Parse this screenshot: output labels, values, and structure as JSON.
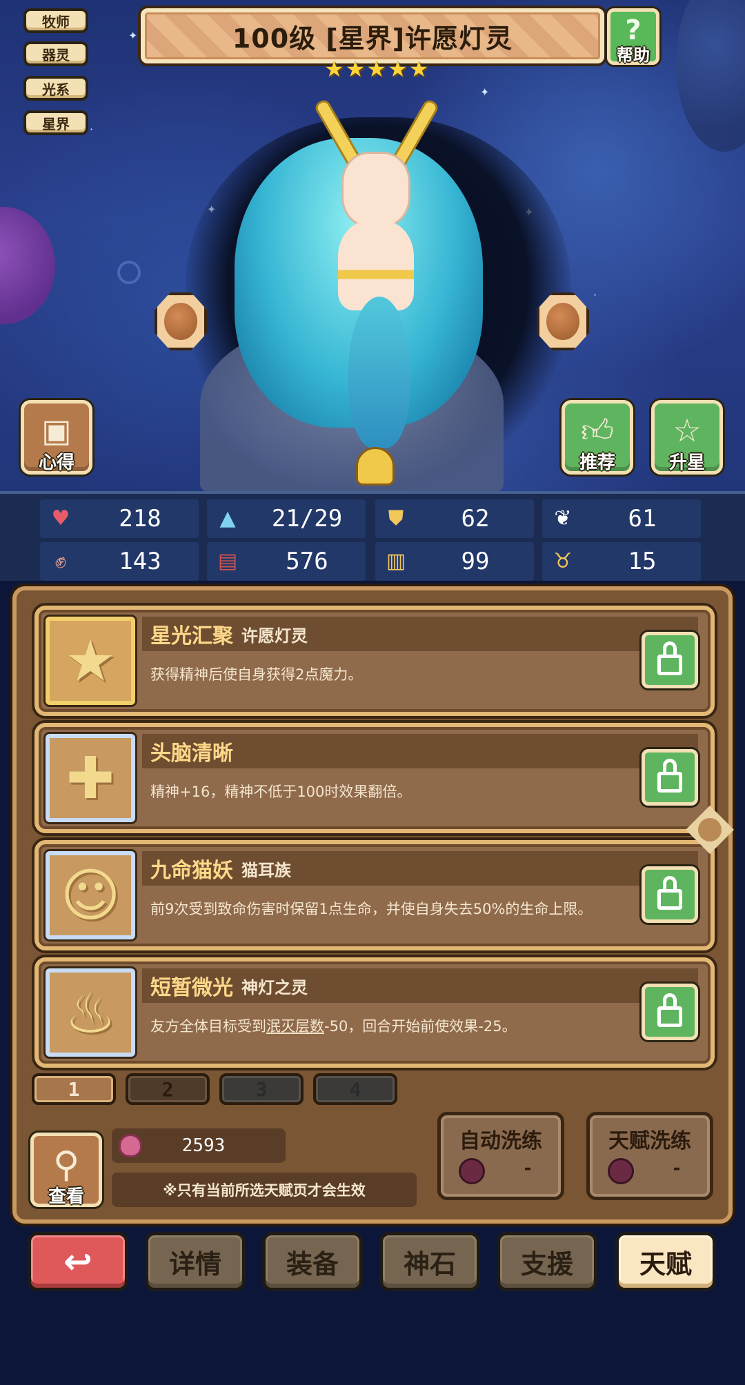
{
  "hero": {
    "tags": [
      "牧师",
      "器灵",
      "光系",
      "星界"
    ],
    "title": "100级 [星界]许愿灯灵",
    "star_count": 5,
    "help_label": "帮助",
    "left_button_label": "心得",
    "recommend_label": "推荐",
    "upgrade_star_label": "升星"
  },
  "stats": [
    {
      "icon": "heart-icon",
      "value": "218",
      "color": "#e85c6a"
    },
    {
      "icon": "water-drop-icon",
      "value": "21/29",
      "color": "#7fd3f0"
    },
    {
      "icon": "shield-icon",
      "value": "62",
      "color": "#f3c85a"
    },
    {
      "icon": "wing-icon",
      "value": "61",
      "color": "#ffffff"
    },
    {
      "icon": "fist-icon",
      "value": "143",
      "color": "#f0a58c"
    },
    {
      "icon": "book-icon",
      "value": "576",
      "color": "#d0534e"
    },
    {
      "icon": "scroll-icon",
      "value": "99",
      "color": "#f3c85a"
    },
    {
      "icon": "horn-cup-icon",
      "value": "15",
      "color": "#f3c85a"
    }
  ],
  "talents": [
    {
      "name": "星光汇聚",
      "sub": "许愿灯灵",
      "desc": "获得精神后使自身获得2点魔力。",
      "icon": "star-icon"
    },
    {
      "name": "头脑清晰",
      "sub": "",
      "desc": "精神+16，精神不低于100时效果翻倍。",
      "icon": "cross-icon"
    },
    {
      "name": "九命猫妖",
      "sub": "猫耳族",
      "desc": "前9次受到致命伤害时保留1点生命，并使自身失去50%的生命上限。",
      "icon": "cat-icon"
    },
    {
      "name": "短暂微光",
      "sub": "神灯之灵",
      "desc_pre": "友方全体目标受到",
      "desc_link": "泯灭层数",
      "desc_post": "-50，回合开始前使效果-25。",
      "icon": "magic-lamp-icon"
    }
  ],
  "pages": [
    "1",
    "2",
    "3",
    "4"
  ],
  "currency": {
    "amount": "2593"
  },
  "note": "※只有当前所选天赋页才会生效",
  "view_label": "查看",
  "auto_wash": {
    "label": "自动洗练",
    "cost": "-"
  },
  "talent_wash": {
    "label": "天赋洗练",
    "cost": "-"
  },
  "nav": {
    "back_glyph": "↩",
    "details": "详情",
    "equipment": "装备",
    "god_stone": "神石",
    "support": "支援",
    "talent": "天赋"
  }
}
